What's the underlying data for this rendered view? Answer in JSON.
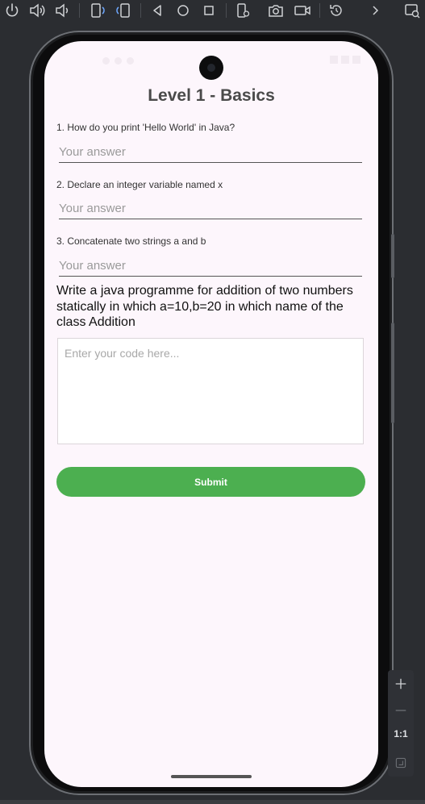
{
  "toolbar": {
    "icons": [
      "power-icon",
      "volume-up-icon",
      "volume-down-icon",
      "rotate-left-icon",
      "rotate-right-icon",
      "back-icon",
      "home-icon",
      "overview-icon",
      "device-settings-icon",
      "screenshot-icon",
      "screen-record-icon",
      "snapshot-icon",
      "more-icon",
      "extended-controls-icon"
    ]
  },
  "app": {
    "title": "Level 1 - Basics",
    "questions": [
      {
        "label": "1. How do you print 'Hello World' in Java?",
        "placeholder": "Your answer"
      },
      {
        "label": "2. Declare an integer variable named x",
        "placeholder": "Your answer"
      },
      {
        "label": "3. Concatenate two strings a and b",
        "placeholder": "Your answer"
      }
    ],
    "prompt": "Write a java programme for addition of two numbers statically in which a=10,b=20 in which  name of the class Addition",
    "code_placeholder": "Enter your code here...",
    "submit_label": "Submit"
  },
  "zoom": {
    "ratio_label": "1:1"
  },
  "colors": {
    "accent": "#4caf50",
    "screen_background": "#fdf6fc",
    "emulator_background": "#2b2d31"
  }
}
